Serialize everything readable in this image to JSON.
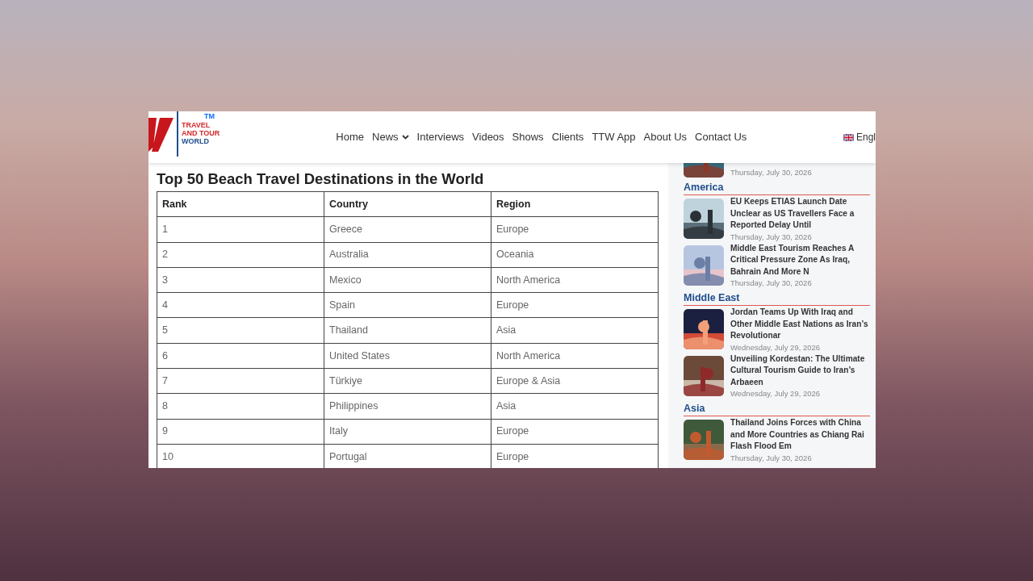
{
  "logo": {
    "trademark": "TM",
    "lines": [
      {
        "text": "TRAVEL",
        "color": "#d42a2a"
      },
      {
        "text": "AND TOUR",
        "color": "#d42a2a"
      },
      {
        "text": "WORLD",
        "color": "#1f4e8c"
      }
    ]
  },
  "nav": [
    {
      "label": "Home",
      "dropdown": false
    },
    {
      "label": "News",
      "dropdown": true
    },
    {
      "label": "Interviews",
      "dropdown": false
    },
    {
      "label": "Videos",
      "dropdown": false
    },
    {
      "label": "Shows",
      "dropdown": false
    },
    {
      "label": "Clients",
      "dropdown": false
    },
    {
      "label": "TTW App",
      "dropdown": false
    },
    {
      "label": "About Us",
      "dropdown": false
    },
    {
      "label": "Contact Us",
      "dropdown": false
    }
  ],
  "language": "Engl",
  "article": {
    "title": "Top 50 Beach Travel Destinations in the World",
    "table": {
      "columns": [
        "Rank",
        "Country",
        "Region"
      ],
      "rows": [
        [
          "1",
          "Greece",
          "Europe"
        ],
        [
          "2",
          "Australia",
          "Oceania"
        ],
        [
          "3",
          "Mexico",
          "North America"
        ],
        [
          "4",
          "Spain",
          "Europe"
        ],
        [
          "5",
          "Thailand",
          "Asia"
        ],
        [
          "6",
          "United States",
          "North America"
        ],
        [
          "7",
          "Türkiye",
          "Europe & Asia"
        ],
        [
          "8",
          "Philippines",
          "Asia"
        ],
        [
          "9",
          "Italy",
          "Europe"
        ],
        [
          "10",
          "Portugal",
          "Europe"
        ]
      ]
    }
  },
  "sidebar": {
    "top_item": {
      "date": "Thursday, July 30, 2026"
    },
    "sections": [
      {
        "heading": "America",
        "items": [
          {
            "title": "EU Keeps ETIAS Launch Date Unclear as US Travellers Face a Reported Delay Until",
            "date": "Thursday, July 30, 2026"
          },
          {
            "title": "Middle East Tourism Reaches A Critical Pressure Zone As Iraq, Bahrain And More N",
            "date": "Thursday, July 30, 2026"
          }
        ]
      },
      {
        "heading": "Middle East",
        "items": [
          {
            "title": "Jordan Teams Up With Iraq and Other Middle East Nations as Iran’s Revolutionar",
            "date": "Wednesday, July 29, 2026"
          },
          {
            "title": "Unveiling Kordestan: The Ultimate Cultural Tourism Guide to Iran’s Arbaeen",
            "date": "Wednesday, July 29, 2026"
          }
        ]
      },
      {
        "heading": "Asia",
        "items": [
          {
            "title": "Thailand Joins Forces with China and More Countries as Chiang Rai Flash Flood Em",
            "date": "Thursday, July 30, 2026"
          }
        ]
      }
    ]
  }
}
